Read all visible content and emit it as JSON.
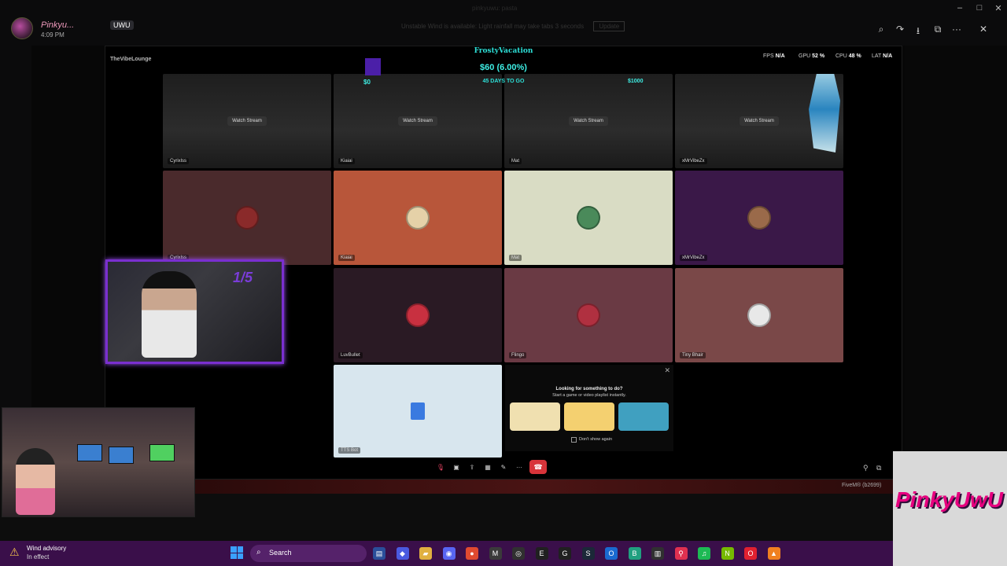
{
  "viewer": {
    "poster_name": "Pinkyu...",
    "poster_badge": "UWU",
    "poster_time": "4:09 PM",
    "tab_title": "pinkyuwu: pasta",
    "notice": "Unstable Wind is available: Light rainfall may take tabs 3 seconds",
    "notice_button": "Update"
  },
  "window_controls": {
    "minimize": "–",
    "maximize": "□",
    "close": "✕"
  },
  "viewer_icons": {
    "zoom": "⌕",
    "share": "↷",
    "download": "⭳",
    "open": "⧉",
    "more": "···",
    "close": "✕"
  },
  "discord": {
    "server_name": "TheVibeLounge",
    "stats": {
      "fps_label": "FPS",
      "fps": "N/A",
      "gpu_label": "GPU",
      "gpu": "52 %",
      "cpu_label": "CPU",
      "cpu": "48 %",
      "lat_label": "LAT",
      "lat": "N/A"
    }
  },
  "donation": {
    "title": "FrostyVacation",
    "amount": "$60 (6.00%)",
    "days": "45 DAYS TO GO",
    "min": "$0",
    "max": "$1000",
    "progress": 0.06
  },
  "stream_tiles": [
    {
      "name": "Cyrixlss",
      "button": "Watch Stream"
    },
    {
      "name": "Kiaiai",
      "button": "Watch Stream"
    },
    {
      "name": "Mat",
      "button": "Watch Stream"
    },
    {
      "name": "xMrVibeZx",
      "button": "Watch Stream"
    }
  ],
  "user_tiles_row2": [
    {
      "name": "Cyrixlss",
      "bg": "#4a2a2c",
      "avatar": "#8a2a2a"
    },
    {
      "name": "Kiaiai",
      "bg": "#b8563a",
      "avatar": "#e5d1a8"
    },
    {
      "name": "Mat",
      "bg": "#d9dcc4",
      "avatar": "#4a8a5a"
    },
    {
      "name": "xMrVibeZx",
      "bg": "#3a1848",
      "avatar": "#9a6a4a"
    }
  ],
  "user_tiles_row3": [
    {
      "name": "LuvBullet",
      "bg": "#2a1a24",
      "avatar": "#c83040"
    },
    {
      "name": "Flingo",
      "bg": "#6a3a44",
      "avatar": "#b03040"
    },
    {
      "name": "Tiny Bhair",
      "bg": "#7a4848",
      "avatar": "#e8e8e8"
    }
  ],
  "tts_tile": {
    "name": "TTS Bot",
    "bg": "#d8e6ee"
  },
  "webcam": {
    "counter": "1/5"
  },
  "activity": {
    "close": "✕",
    "line1": "Looking for something to do?",
    "line2": "Start a game or video playlist instantly.",
    "dont_show": "Don't show again",
    "cards": [
      "#f0e0b0",
      "#f4d070",
      "#40a0c0"
    ]
  },
  "controls": {
    "mic": "🎙",
    "camera": "▣",
    "share": "⇪",
    "grid": "▦",
    "pencil": "✎",
    "more": "···",
    "hangup": "☎"
  },
  "bottom": {
    "fivem": "FiveM® (b2699)"
  },
  "logo": {
    "text": "PinkyUwU"
  },
  "taskbar": {
    "weather_title": "Wind advisory",
    "weather_sub": "In effect",
    "search": "Search",
    "apps": [
      {
        "name": "files",
        "color": "#2a4e9a",
        "glyph": "▤"
      },
      {
        "name": "copilot",
        "color": "#4a5ae0",
        "glyph": "◆"
      },
      {
        "name": "folder",
        "color": "#e0b040",
        "glyph": "▰"
      },
      {
        "name": "discord",
        "color": "#5865f2",
        "glyph": "◉"
      },
      {
        "name": "chrome",
        "color": "#e04a30",
        "glyph": "●"
      },
      {
        "name": "mail",
        "color": "#3a3a3a",
        "glyph": "M"
      },
      {
        "name": "obs",
        "color": "#303030",
        "glyph": "◎"
      },
      {
        "name": "epic",
        "color": "#202020",
        "glyph": "E"
      },
      {
        "name": "github",
        "color": "#202020",
        "glyph": "G"
      },
      {
        "name": "steam",
        "color": "#1b2838",
        "glyph": "S"
      },
      {
        "name": "outlook",
        "color": "#1a6ad0",
        "glyph": "O"
      },
      {
        "name": "bot",
        "color": "#20a080",
        "glyph": "B"
      },
      {
        "name": "audio",
        "color": "#303030",
        "glyph": "▥"
      },
      {
        "name": "maps",
        "color": "#e03050",
        "glyph": "⚲"
      },
      {
        "name": "spotify",
        "color": "#1db954",
        "glyph": "♫"
      },
      {
        "name": "nvidia",
        "color": "#76b900",
        "glyph": "N"
      },
      {
        "name": "opera",
        "color": "#e02030",
        "glyph": "O"
      },
      {
        "name": "vlc",
        "color": "#f08020",
        "glyph": "▲"
      }
    ]
  }
}
